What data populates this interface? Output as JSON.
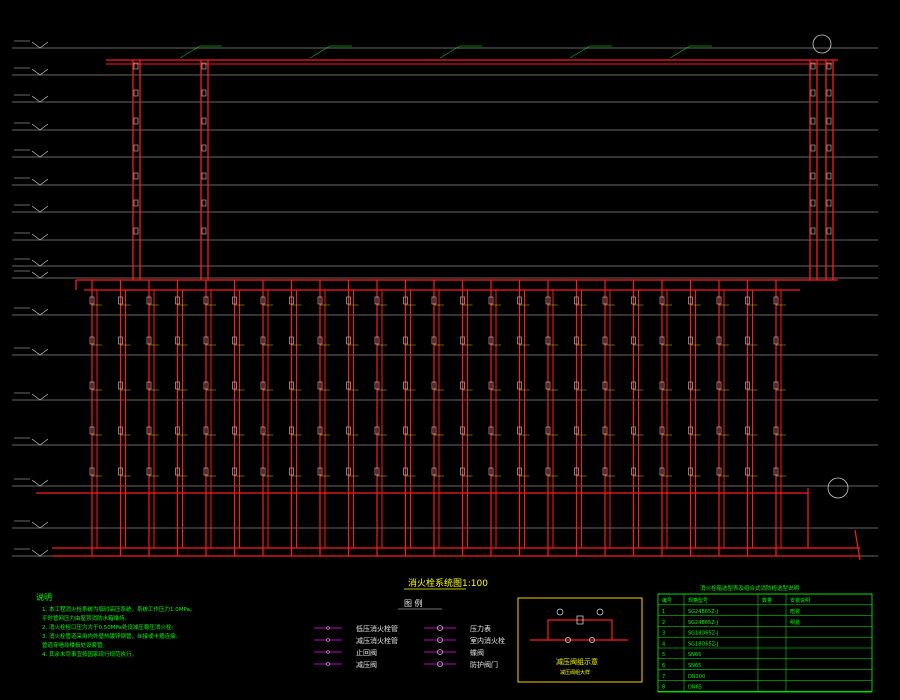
{
  "diagram": {
    "title": "消火栓系统图1:100",
    "background": "#000000",
    "colors": {
      "pipe": "#ff1a1a",
      "floor_line": "#d0d0d0",
      "text": "#ffff00",
      "note": "#00ff00",
      "box": "#ffd000",
      "table": "#00ff00"
    }
  },
  "notes": {
    "heading": "说明",
    "lines": [
      "1. 本工程消火栓系统为临时高压系统，系统工作压力1.0MPa。",
      "   平时管网压力由屋顶消防水箱维持。",
      "2. 消火栓栓口压力大于0.50MPa处设减压稳压消火栓。",
      "3. 消火栓管道采用内外壁热镀锌钢管，丝接或卡箍连接。",
      "   管道穿墙及楼板处设套管。",
      "4. 其余未尽事宜按国家现行规范执行。"
    ]
  },
  "legend": {
    "heading": "图    例",
    "items": [
      {
        "label": "低压消火栓管"
      },
      {
        "label": "减压消火栓管"
      },
      {
        "label": "止回阀"
      },
      {
        "label": "减压阀"
      },
      {
        "label": "压力表"
      },
      {
        "label": "室内消火栓"
      },
      {
        "label": "蝶阀"
      },
      {
        "label": "防护阀门"
      }
    ]
  },
  "detail": {
    "caption": "减压阀组示意",
    "subcaption": "减压阀组大样"
  },
  "table": {
    "title": "消火栓箱选型表及组合式消防柜选型说明",
    "header": [
      "编号",
      "规格型号",
      "数量",
      "安装说明"
    ],
    "rows": [
      [
        "1",
        "SG24B65Z-J",
        "",
        "暗装"
      ],
      [
        "2",
        "SG24B65Z-J",
        "",
        "明装"
      ],
      [
        "3",
        "SG18D65Z-J",
        "",
        ""
      ],
      [
        "4",
        "SG18D65Z-J",
        "",
        ""
      ],
      [
        "5",
        "SN65",
        "",
        ""
      ],
      [
        "6",
        "SN65",
        "",
        ""
      ],
      [
        "7",
        "DN100",
        "",
        ""
      ],
      [
        "8",
        "DN65",
        "",
        ""
      ]
    ]
  }
}
